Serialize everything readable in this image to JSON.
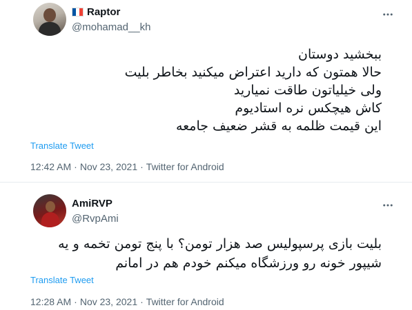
{
  "tweets": [
    {
      "display_name": "Raptor",
      "flag": "france",
      "flag_colors": [
        "#0055A4",
        "#FFFFFF",
        "#EF4135"
      ],
      "handle": "@mohamad__kh",
      "lines": [
        "ببخشید دوستان",
        "حالا همتون که دارید اعتراض میکنید بخاطر بلیت",
        "ولی خیلیاتون طاقت نمیارید",
        "کاش هیچکس نره استادیوم",
        "این قیمت ظلمه به قشر ضعیف جامعه"
      ],
      "translate_label": "Translate Tweet",
      "time": "12:42 AM",
      "date": "Nov 23, 2021",
      "source": "Twitter for Android",
      "separator": "·"
    },
    {
      "display_name": "AmiRVP",
      "handle": "@RvpAmi",
      "lines": [
        "بلیت بازی پرسپولیس صد هزار تومن؟ با پنج تومن تخمه و یه",
        "شیپور خونه رو ورزشگاه میکنم خودم هم در امانم"
      ],
      "translate_label": "Translate Tweet",
      "time": "12:28 AM",
      "date": "Nov 23, 2021",
      "source": "Twitter for Android",
      "separator": "·"
    }
  ],
  "icons": {
    "more": "more-options-icon"
  },
  "colors": {
    "link": "#1d9bf0",
    "secondary_text": "#536471",
    "primary_text": "#0f1419",
    "divider": "#e6ecf0"
  }
}
